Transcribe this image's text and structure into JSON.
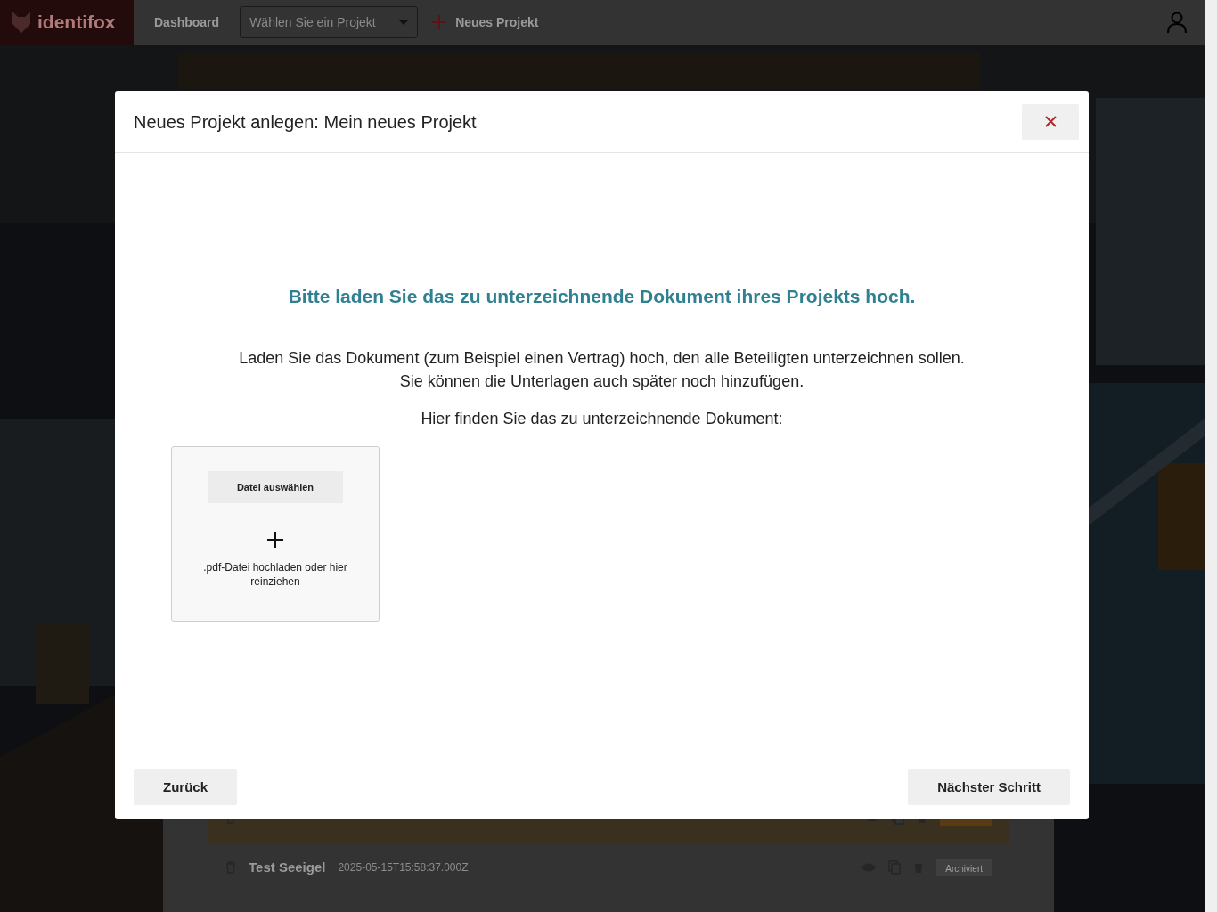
{
  "navbar": {
    "logo": "identifox",
    "links": [
      {
        "label": "Dashboard"
      }
    ],
    "project_select": {
      "placeholder": "Wählen Sie ein Projekt"
    },
    "new_project": "Neues Projekt"
  },
  "background_list": {
    "rows": [
      {
        "title": "",
        "date": "",
        "badge": "",
        "highlighted": true
      },
      {
        "title": "Test Seeigel",
        "date": "2025-05-15T15:58:37.000Z",
        "badge": "Archiviert",
        "highlighted": false
      }
    ]
  },
  "modal": {
    "title": "Neues Projekt anlegen: Mein neues Projekt",
    "heading": "Bitte laden Sie das zu unterzeichnende Dokument ihres Projekts hoch.",
    "description": [
      "Laden Sie das Dokument (zum Beispiel einen Vertrag) hoch, den alle Beteiligten unterzeichnen sollen.",
      "Sie können die Unterlagen auch später noch hinzufügen."
    ],
    "prompt": "Hier finden Sie das zu unterzeichnende Dokument:",
    "upload": {
      "button": "Datei auswählen",
      "hint": ".pdf-Datei hochladen oder hier reinziehen"
    },
    "back_button": "Zurück",
    "next_button": "Nächster Schritt"
  }
}
